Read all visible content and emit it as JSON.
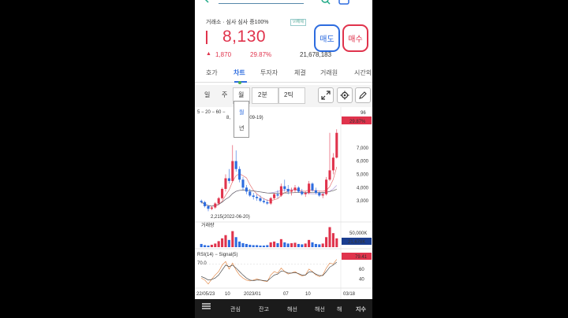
{
  "header": {
    "market_info": "거래소 · 심사 심사 증100%",
    "vi_badge": "VI해제",
    "price": "8,130",
    "change_arrow": "▲",
    "change": "1,870",
    "rate": "29.87%",
    "volume": "21,678,183",
    "sell_label": "매도",
    "buy_label": "매수"
  },
  "tabs": [
    {
      "label": "호가"
    },
    {
      "label": "차트",
      "active": true
    },
    {
      "label": "투자자"
    },
    {
      "label": "체결"
    },
    {
      "label": "거래원"
    },
    {
      "label": "시간외"
    }
  ],
  "toolbar": {
    "periods": [
      "일",
      "주",
      "월",
      "2분",
      "2틱"
    ],
    "selected_period": "월"
  },
  "dropdown": {
    "options": [
      "월",
      "년"
    ]
  },
  "chart": {
    "ma_legend": "5 − 20 − 60 −",
    "high_label": "8,",
    "high_date": "2-09-19)",
    "low_label": "2,215(2022-06-20)",
    "price_current_tag": "8,130",
    "rate_tag": "29.87%",
    "price_axis": [
      "7,000",
      "6,000",
      "5,000",
      "4,000",
      "3,000"
    ],
    "price_axis_top": "96",
    "volume_title": "거래량",
    "volume_axis": "50,000K",
    "volume_current_tag": "21,678K",
    "rsi_title": "RSI(14) − Signal(5)",
    "rsi_tag": "79.41",
    "rsi_axis": [
      "60",
      "40"
    ],
    "rsi_ref": "70.0",
    "x_axis": [
      "22/05/23",
      "10",
      "2023/01",
      "07",
      "10",
      "03/18"
    ],
    "colors": {
      "up": "#e0334c",
      "down": "#2d6cdf"
    }
  },
  "chart_data": {
    "type": "candlestick",
    "title": "",
    "ylim": [
      2000,
      9600
    ],
    "candles_ohlc": [
      [
        3000,
        3100,
        2800,
        2900
      ],
      [
        2900,
        3000,
        2500,
        2600
      ],
      [
        2600,
        2700,
        2215,
        2400
      ],
      [
        2400,
        2600,
        2300,
        2500
      ],
      [
        2500,
        2900,
        2400,
        2800
      ],
      [
        2800,
        3300,
        2700,
        3200
      ],
      [
        3200,
        4000,
        3100,
        3900
      ],
      [
        3900,
        5000,
        3700,
        4700
      ],
      [
        4700,
        5400,
        4300,
        4500
      ],
      [
        4500,
        7200,
        4400,
        6000
      ],
      [
        6000,
        6800,
        5200,
        5400
      ],
      [
        5400,
        5600,
        4400,
        4600
      ],
      [
        4600,
        4800,
        3800,
        4000
      ],
      [
        4000,
        4200,
        3500,
        3700
      ],
      [
        3700,
        3900,
        3300,
        3400
      ],
      [
        3400,
        3600,
        3100,
        3300
      ],
      [
        3300,
        3500,
        3000,
        3200
      ],
      [
        3200,
        3400,
        2900,
        3000
      ],
      [
        3000,
        3200,
        2800,
        2900
      ],
      [
        2900,
        3100,
        2700,
        2800
      ],
      [
        2800,
        3300,
        2700,
        3200
      ],
      [
        3200,
        3600,
        3100,
        3500
      ],
      [
        3500,
        3800,
        3200,
        3400
      ],
      [
        3400,
        4300,
        3300,
        4100
      ],
      [
        4100,
        4600,
        3700,
        3900
      ],
      [
        3900,
        4200,
        3500,
        3700
      ],
      [
        3700,
        4000,
        3400,
        3800
      ],
      [
        3800,
        4200,
        3600,
        4000
      ],
      [
        4000,
        4100,
        3600,
        3700
      ],
      [
        3700,
        3900,
        3400,
        3500
      ],
      [
        3500,
        3700,
        3300,
        3600
      ],
      [
        3600,
        4500,
        3500,
        4300
      ],
      [
        4300,
        4400,
        3700,
        3800
      ],
      [
        3800,
        4000,
        3500,
        3600
      ],
      [
        3600,
        3700,
        3300,
        3400
      ],
      [
        3400,
        3600,
        3200,
        3500
      ],
      [
        3500,
        4800,
        3400,
        4600
      ],
      [
        4600,
        8130,
        4500,
        5300
      ],
      [
        5300,
        6600,
        5000,
        6260
      ],
      [
        6260,
        8400,
        6200,
        8130
      ]
    ],
    "volume": [
      8,
      5,
      4,
      6,
      9,
      15,
      22,
      30,
      18,
      40,
      25,
      14,
      10,
      8,
      6,
      5,
      5,
      4,
      4,
      5,
      12,
      14,
      10,
      20,
      12,
      9,
      10,
      11,
      8,
      7,
      9,
      18,
      12,
      8,
      7,
      9,
      25,
      50,
      35,
      22
    ],
    "rsi": [
      42,
      38,
      30,
      40,
      48,
      55,
      68,
      75,
      60,
      72,
      58,
      48,
      42,
      38,
      36,
      38,
      40,
      38,
      36,
      35,
      48,
      55,
      52,
      62,
      55,
      50,
      52,
      55,
      50,
      46,
      48,
      60,
      55,
      48,
      45,
      48,
      62,
      72,
      70,
      79.41
    ],
    "signal": [
      45,
      42,
      38,
      39,
      42,
      48,
      58,
      68,
      65,
      68,
      62,
      55,
      48,
      42,
      38,
      37,
      38,
      38,
      37,
      36,
      42,
      48,
      50,
      56,
      55,
      52,
      52,
      53,
      51,
      48,
      48,
      54,
      54,
      50,
      47,
      47,
      55,
      64,
      68,
      74
    ]
  }
}
